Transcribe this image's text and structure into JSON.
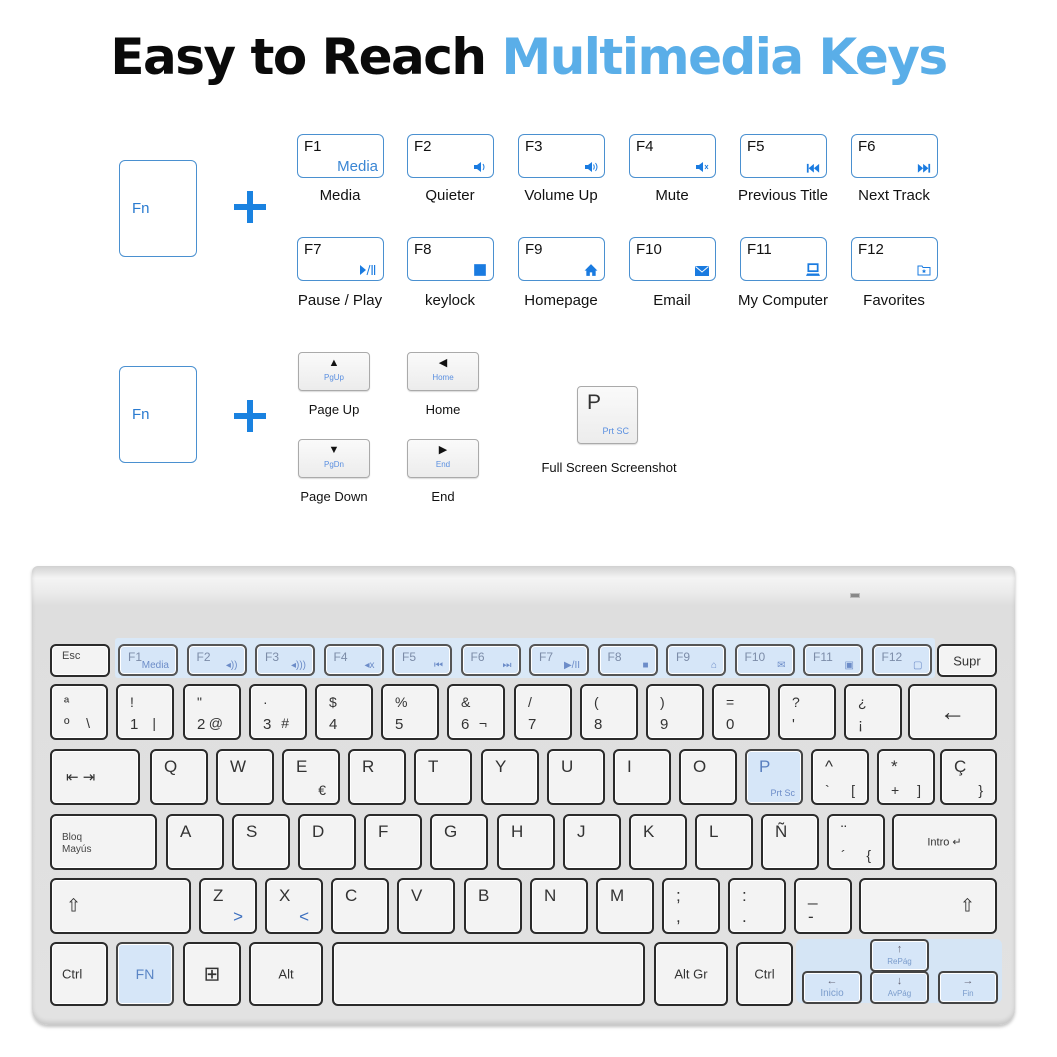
{
  "title": {
    "part1": "Easy to Reach",
    "part2": "Multimedia Keys"
  },
  "colors": {
    "accent": "#5aaee8",
    "key_border": "#4a90d0",
    "plus": "#1a82e0",
    "highlight": "#d6e6f8"
  },
  "legend_fn": {
    "fn_label": "Fn",
    "keys": [
      {
        "key": "F1",
        "sub": "Media",
        "icon": "media-text",
        "label": "Media"
      },
      {
        "key": "F2",
        "icon": "volume-down-icon",
        "label": "Quieter"
      },
      {
        "key": "F3",
        "icon": "volume-up-icon",
        "label": "Volume Up"
      },
      {
        "key": "F4",
        "icon": "mute-icon",
        "label": "Mute"
      },
      {
        "key": "F5",
        "icon": "previous-track-icon",
        "label": "Previous Title"
      },
      {
        "key": "F6",
        "icon": "next-track-icon",
        "label": "Next Track"
      },
      {
        "key": "F7",
        "icon": "play-pause-icon",
        "label": "Pause / Play"
      },
      {
        "key": "F8",
        "icon": "stop-icon",
        "label": "keylock"
      },
      {
        "key": "F9",
        "icon": "home-icon",
        "label": "Homepage"
      },
      {
        "key": "F10",
        "icon": "mail-icon",
        "label": "Email"
      },
      {
        "key": "F11",
        "icon": "computer-icon",
        "label": "My Computer"
      },
      {
        "key": "F12",
        "icon": "favorites-folder-icon",
        "label": "Favorites"
      }
    ]
  },
  "legend_nav": {
    "fn_label": "Fn",
    "keys": [
      {
        "arrow": "▲",
        "sub": "PgUp",
        "label": "Page Up"
      },
      {
        "arrow": "◀",
        "sub": "Home",
        "label": "Home"
      },
      {
        "arrow": "▼",
        "sub": "PgDn",
        "label": "Page Down"
      },
      {
        "arrow": "▶",
        "sub": "End",
        "label": "End"
      }
    ],
    "print": {
      "key": "P",
      "sub": "Prt SC",
      "label": "Full Screen Screenshot"
    }
  },
  "keyboard": {
    "esc": "Esc",
    "fkeys": [
      {
        "key": "F1",
        "sub": "Media"
      },
      {
        "key": "F2",
        "sub": "◂))"
      },
      {
        "key": "F3",
        "sub": "◂)))"
      },
      {
        "key": "F4",
        "sub": "◂x"
      },
      {
        "key": "F5",
        "sub": "⏮"
      },
      {
        "key": "F6",
        "sub": "⏭"
      },
      {
        "key": "F7",
        "sub": "▶/II"
      },
      {
        "key": "F8",
        "sub": "■"
      },
      {
        "key": "F9",
        "sub": "⌂"
      },
      {
        "key": "F10",
        "sub": "✉"
      },
      {
        "key": "F11",
        "sub": "▣"
      },
      {
        "key": "F12",
        "sub": "▢"
      }
    ],
    "supr": "Supr",
    "number_row": [
      {
        "top": "ª",
        "bottom": "º",
        "alt": "\\"
      },
      {
        "top": "!",
        "bottom": "1",
        "alt": "|"
      },
      {
        "top": "\"",
        "bottom": "2",
        "alt": "@"
      },
      {
        "top": "·",
        "bottom": "3",
        "alt": "#"
      },
      {
        "top": "$",
        "bottom": "4",
        "alt": ""
      },
      {
        "top": "%",
        "bottom": "5",
        "alt": ""
      },
      {
        "top": "&",
        "bottom": "6",
        "alt": "¬"
      },
      {
        "top": "/",
        "bottom": "7",
        "alt": ""
      },
      {
        "top": "(",
        "bottom": "8",
        "alt": ""
      },
      {
        "top": ")",
        "bottom": "9",
        "alt": ""
      },
      {
        "top": "=",
        "bottom": "0",
        "alt": ""
      },
      {
        "top": "?",
        "bottom": "'",
        "alt": ""
      },
      {
        "top": "¿",
        "bottom": "¡",
        "alt": ""
      }
    ],
    "backspace": "←",
    "tab": "⇤ ⇥",
    "qwerty_row": [
      {
        "top": "Q"
      },
      {
        "top": "W"
      },
      {
        "top": "E",
        "alt": "€"
      },
      {
        "top": "R"
      },
      {
        "top": "T"
      },
      {
        "top": "Y"
      },
      {
        "top": "U"
      },
      {
        "top": "I"
      },
      {
        "top": "O"
      },
      {
        "top": "P",
        "alt": "Prt Sc"
      },
      {
        "top": "^",
        "bottom": "`",
        "alt": "["
      },
      {
        "top": "*",
        "bottom": "+",
        "alt": "]"
      },
      {
        "top": "Ç",
        "alt": "}"
      }
    ],
    "caps": {
      "line1": "Bloq",
      "line2": "Mayús"
    },
    "asdf_row": [
      {
        "top": "A"
      },
      {
        "top": "S"
      },
      {
        "top": "D"
      },
      {
        "top": "F"
      },
      {
        "top": "G"
      },
      {
        "top": "H"
      },
      {
        "top": "J"
      },
      {
        "top": "K"
      },
      {
        "top": "L"
      },
      {
        "top": "Ñ"
      },
      {
        "top": "¨",
        "bottom": "´",
        "alt": "{"
      }
    ],
    "enter": "Intro ↵",
    "shift_icon": "⇧",
    "zxcv_row": [
      {
        "top": "Z",
        "alt": ">"
      },
      {
        "top": "X",
        "alt": "<"
      },
      {
        "top": "C"
      },
      {
        "top": "V"
      },
      {
        "top": "B"
      },
      {
        "top": "N"
      },
      {
        "top": "M"
      },
      {
        "top": ";",
        "bottom": ","
      },
      {
        "top": ":",
        "bottom": "."
      },
      {
        "top": "_",
        "bottom": "-"
      }
    ],
    "bottom_row": {
      "ctrl_left": "Ctrl",
      "fn": "FN",
      "win": "⊞",
      "alt": "Alt",
      "space": "",
      "altgr": "Alt Gr",
      "ctrl_right": "Ctrl"
    },
    "nav": {
      "up": {
        "arrow": "↑",
        "label": "RePág"
      },
      "down": {
        "arrow": "↓",
        "label": "AvPág"
      },
      "left": {
        "arrow": "←",
        "label": "Inicio"
      },
      "right": {
        "arrow": "→",
        "label": "Fin"
      }
    }
  }
}
